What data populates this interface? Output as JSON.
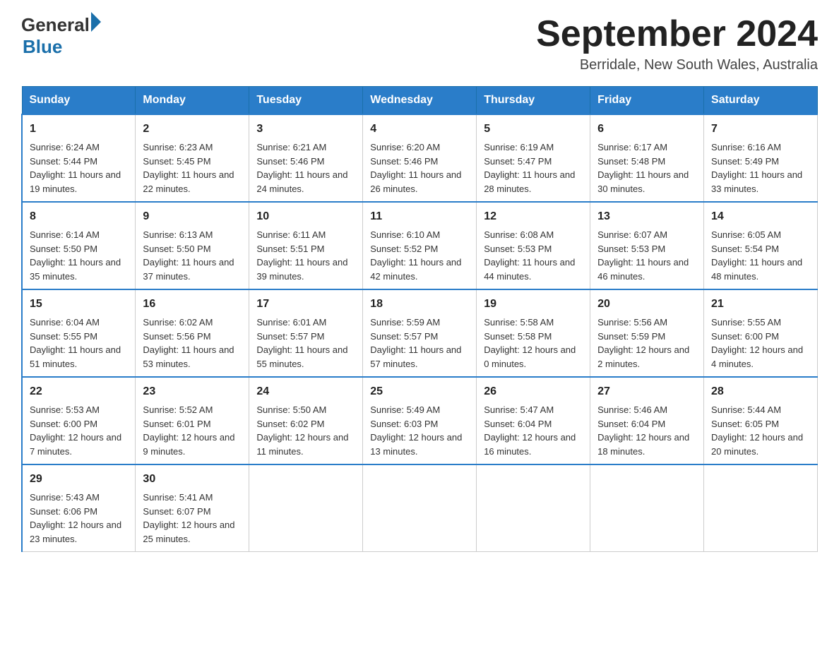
{
  "logo": {
    "general": "General",
    "blue": "Blue",
    "triangle": "▶"
  },
  "title": "September 2024",
  "subtitle": "Berridale, New South Wales, Australia",
  "days_of_week": [
    "Sunday",
    "Monday",
    "Tuesday",
    "Wednesday",
    "Thursday",
    "Friday",
    "Saturday"
  ],
  "weeks": [
    [
      {
        "day": "1",
        "sunrise": "6:24 AM",
        "sunset": "5:44 PM",
        "daylight": "11 hours and 19 minutes."
      },
      {
        "day": "2",
        "sunrise": "6:23 AM",
        "sunset": "5:45 PM",
        "daylight": "11 hours and 22 minutes."
      },
      {
        "day": "3",
        "sunrise": "6:21 AM",
        "sunset": "5:46 PM",
        "daylight": "11 hours and 24 minutes."
      },
      {
        "day": "4",
        "sunrise": "6:20 AM",
        "sunset": "5:46 PM",
        "daylight": "11 hours and 26 minutes."
      },
      {
        "day": "5",
        "sunrise": "6:19 AM",
        "sunset": "5:47 PM",
        "daylight": "11 hours and 28 minutes."
      },
      {
        "day": "6",
        "sunrise": "6:17 AM",
        "sunset": "5:48 PM",
        "daylight": "11 hours and 30 minutes."
      },
      {
        "day": "7",
        "sunrise": "6:16 AM",
        "sunset": "5:49 PM",
        "daylight": "11 hours and 33 minutes."
      }
    ],
    [
      {
        "day": "8",
        "sunrise": "6:14 AM",
        "sunset": "5:50 PM",
        "daylight": "11 hours and 35 minutes."
      },
      {
        "day": "9",
        "sunrise": "6:13 AM",
        "sunset": "5:50 PM",
        "daylight": "11 hours and 37 minutes."
      },
      {
        "day": "10",
        "sunrise": "6:11 AM",
        "sunset": "5:51 PM",
        "daylight": "11 hours and 39 minutes."
      },
      {
        "day": "11",
        "sunrise": "6:10 AM",
        "sunset": "5:52 PM",
        "daylight": "11 hours and 42 minutes."
      },
      {
        "day": "12",
        "sunrise": "6:08 AM",
        "sunset": "5:53 PM",
        "daylight": "11 hours and 44 minutes."
      },
      {
        "day": "13",
        "sunrise": "6:07 AM",
        "sunset": "5:53 PM",
        "daylight": "11 hours and 46 minutes."
      },
      {
        "day": "14",
        "sunrise": "6:05 AM",
        "sunset": "5:54 PM",
        "daylight": "11 hours and 48 minutes."
      }
    ],
    [
      {
        "day": "15",
        "sunrise": "6:04 AM",
        "sunset": "5:55 PM",
        "daylight": "11 hours and 51 minutes."
      },
      {
        "day": "16",
        "sunrise": "6:02 AM",
        "sunset": "5:56 PM",
        "daylight": "11 hours and 53 minutes."
      },
      {
        "day": "17",
        "sunrise": "6:01 AM",
        "sunset": "5:57 PM",
        "daylight": "11 hours and 55 minutes."
      },
      {
        "day": "18",
        "sunrise": "5:59 AM",
        "sunset": "5:57 PM",
        "daylight": "11 hours and 57 minutes."
      },
      {
        "day": "19",
        "sunrise": "5:58 AM",
        "sunset": "5:58 PM",
        "daylight": "12 hours and 0 minutes."
      },
      {
        "day": "20",
        "sunrise": "5:56 AM",
        "sunset": "5:59 PM",
        "daylight": "12 hours and 2 minutes."
      },
      {
        "day": "21",
        "sunrise": "5:55 AM",
        "sunset": "6:00 PM",
        "daylight": "12 hours and 4 minutes."
      }
    ],
    [
      {
        "day": "22",
        "sunrise": "5:53 AM",
        "sunset": "6:00 PM",
        "daylight": "12 hours and 7 minutes."
      },
      {
        "day": "23",
        "sunrise": "5:52 AM",
        "sunset": "6:01 PM",
        "daylight": "12 hours and 9 minutes."
      },
      {
        "day": "24",
        "sunrise": "5:50 AM",
        "sunset": "6:02 PM",
        "daylight": "12 hours and 11 minutes."
      },
      {
        "day": "25",
        "sunrise": "5:49 AM",
        "sunset": "6:03 PM",
        "daylight": "12 hours and 13 minutes."
      },
      {
        "day": "26",
        "sunrise": "5:47 AM",
        "sunset": "6:04 PM",
        "daylight": "12 hours and 16 minutes."
      },
      {
        "day": "27",
        "sunrise": "5:46 AM",
        "sunset": "6:04 PM",
        "daylight": "12 hours and 18 minutes."
      },
      {
        "day": "28",
        "sunrise": "5:44 AM",
        "sunset": "6:05 PM",
        "daylight": "12 hours and 20 minutes."
      }
    ],
    [
      {
        "day": "29",
        "sunrise": "5:43 AM",
        "sunset": "6:06 PM",
        "daylight": "12 hours and 23 minutes."
      },
      {
        "day": "30",
        "sunrise": "5:41 AM",
        "sunset": "6:07 PM",
        "daylight": "12 hours and 25 minutes."
      },
      null,
      null,
      null,
      null,
      null
    ]
  ],
  "labels": {
    "sunrise_prefix": "Sunrise: ",
    "sunset_prefix": "Sunset: ",
    "daylight_prefix": "Daylight: "
  }
}
